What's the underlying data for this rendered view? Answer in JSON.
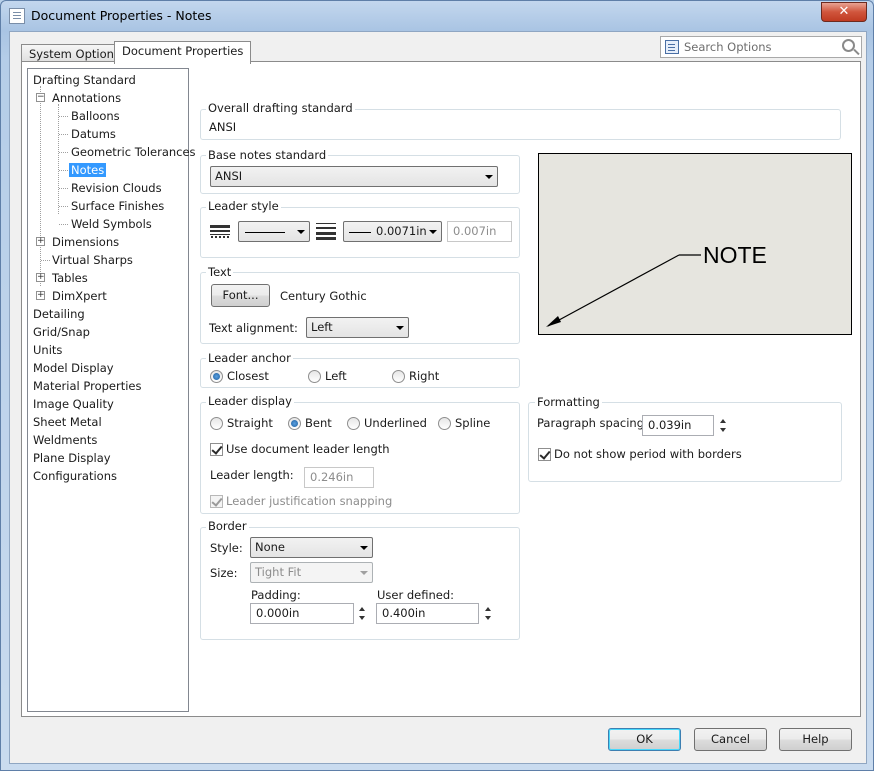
{
  "window": {
    "title": "Document Properties - Notes",
    "close_glyph": "✕"
  },
  "tabs": [
    {
      "label": "System Options",
      "active": false
    },
    {
      "label": "Document Properties",
      "active": true
    }
  ],
  "search": {
    "placeholder": "Search Options"
  },
  "tree": {
    "drafting_standard": "Drafting Standard",
    "annotations": "Annotations",
    "balloons": "Balloons",
    "datums": "Datums",
    "geometric_tolerances": "Geometric Tolerances",
    "notes": "Notes",
    "revision_clouds": "Revision Clouds",
    "surface_finishes": "Surface Finishes",
    "weld_symbols": "Weld Symbols",
    "dimensions": "Dimensions",
    "virtual_sharps": "Virtual Sharps",
    "tables": "Tables",
    "dimxpert": "DimXpert",
    "detailing": "Detailing",
    "grid_snap": "Grid/Snap",
    "units": "Units",
    "model_display": "Model Display",
    "material_properties": "Material Properties",
    "image_quality": "Image Quality",
    "sheet_metal": "Sheet Metal",
    "weldments": "Weldments",
    "plane_display": "Plane Display",
    "configurations": "Configurations",
    "expand_glyph": "+",
    "collapse_glyph": "−"
  },
  "overall": {
    "title": "Overall drafting standard",
    "value": "ANSI"
  },
  "base_notes": {
    "title": "Base notes standard",
    "value": "ANSI"
  },
  "leader_style": {
    "title": "Leader style",
    "thickness_value": "0.0071in",
    "custom_value": "0.007in"
  },
  "text": {
    "title": "Text",
    "font_button": "Font...",
    "font_name": "Century Gothic",
    "alignment_label": "Text alignment:",
    "alignment_value": "Left"
  },
  "leader_anchor": {
    "title": "Leader anchor",
    "closest": "Closest",
    "left": "Left",
    "right": "Right"
  },
  "leader_display": {
    "title": "Leader display",
    "straight": "Straight",
    "bent": "Bent",
    "underlined": "Underlined",
    "spline": "Spline",
    "use_doc_length": "Use document leader length",
    "length_label": "Leader length:",
    "length_value": "0.246in",
    "justification": "Leader justification snapping"
  },
  "border": {
    "title": "Border",
    "style_label": "Style:",
    "style_value": "None",
    "size_label": "Size:",
    "size_value": "Tight Fit",
    "padding_label": "Padding:",
    "padding_value": "0.000in",
    "user_defined_label": "User defined:",
    "user_defined_value": "0.400in"
  },
  "preview": {
    "note_text": "NOTE"
  },
  "formatting": {
    "title": "Formatting",
    "paragraph_label": "Paragraph spacing:",
    "paragraph_value": "0.039in",
    "no_period": "Do not show period with borders"
  },
  "buttons": {
    "ok": "OK",
    "cancel": "Cancel",
    "help": "Help"
  }
}
